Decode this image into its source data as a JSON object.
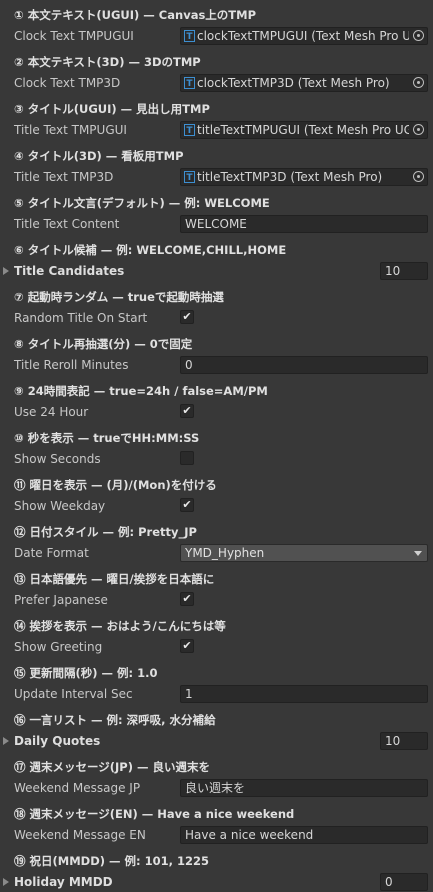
{
  "sections": [
    {
      "header": "① 本文テキスト(UGUI) — Canvas上のTMP",
      "label": "Clock Text TMPUGUI",
      "value": "clockTextTMPUGUI (Text Mesh Pro U"
    },
    {
      "header": "② 本文テキスト(3D) — 3DのTMP",
      "label": "Clock Text TMP3D",
      "value": "clockTextTMP3D (Text Mesh Pro)"
    },
    {
      "header": "③ タイトル(UGUI) — 見出し用TMP",
      "label": "Title Text TMPUGUI",
      "value": "titleTextTMPUGUI (Text Mesh Pro UGU"
    },
    {
      "header": "④ タイトル(3D) — 看板用TMP",
      "label": "Title Text TMP3D",
      "value": "titleTextTMP3D (Text Mesh Pro)"
    },
    {
      "header": "⑤ タイトル文言(デフォルト) — 例: WELCOME",
      "label": "Title Text Content",
      "value": "WELCOME"
    },
    {
      "header": "⑥ タイトル候補 — 例: WELCOME,CHILL,HOME",
      "label": "Title Candidates",
      "value": "10"
    },
    {
      "header": "⑦ 起動時ランダム — trueで起動時抽選",
      "label": "Random Title On Start",
      "value": "✔"
    },
    {
      "header": "⑧ タイトル再抽選(分) — 0で固定",
      "label": "Title Reroll Minutes",
      "value": "0"
    },
    {
      "header": "⑨ 24時間表記 — true=24h / false=AM/PM",
      "label": "Use 24 Hour",
      "value": "✔"
    },
    {
      "header": "⑩ 秒を表示 — trueでHH:MM:SS",
      "label": "Show Seconds",
      "value": ""
    },
    {
      "header": "⑪ 曜日を表示 — (月)/(Mon)を付ける",
      "label": "Show Weekday",
      "value": "✔"
    },
    {
      "header": "⑫ 日付スタイル — 例: Pretty_JP",
      "label": "Date Format",
      "value": "YMD_Hyphen"
    },
    {
      "header": "⑬ 日本語優先 — 曜日/挨拶を日本語に",
      "label": "Prefer Japanese",
      "value": "✔"
    },
    {
      "header": "⑭ 挨拶を表示 — おはよう/こんにちは等",
      "label": "Show Greeting",
      "value": "✔"
    },
    {
      "header": "⑮ 更新間隔(秒) — 例: 1.0",
      "label": "Update Interval Sec",
      "value": "1"
    },
    {
      "header": "⑯ 一言リスト — 例: 深呼吸, 水分補給",
      "label": "Daily Quotes",
      "value": "10"
    },
    {
      "header": "⑰ 週末メッセージ(JP) — 良い週末を",
      "label": "Weekend Message JP",
      "value": "良い週末を"
    },
    {
      "header": "⑱ 週末メッセージ(EN) — Have a nice weekend",
      "label": "Weekend Message EN",
      "value": "Have a nice weekend"
    },
    {
      "header": "⑲ 祝日(MMDD) — 例: 101, 1225",
      "label": "Holiday MMDD",
      "value": "0"
    }
  ],
  "icons": {
    "tmp_icon_glyph": "T"
  }
}
